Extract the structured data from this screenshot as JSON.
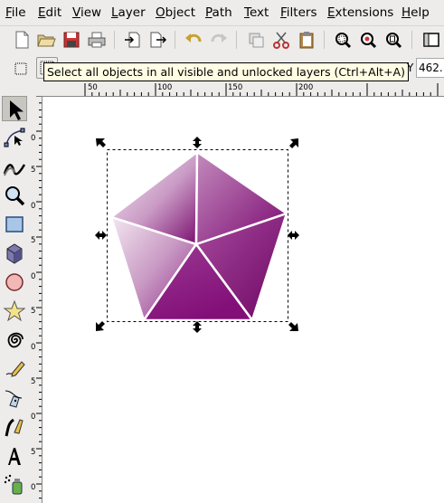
{
  "menu": [
    {
      "mnemonic": "F",
      "rest": "ile"
    },
    {
      "mnemonic": "E",
      "rest": "dit"
    },
    {
      "mnemonic": "V",
      "rest": "iew"
    },
    {
      "mnemonic": "L",
      "rest": "ayer"
    },
    {
      "mnemonic": "O",
      "rest": "bject"
    },
    {
      "mnemonic": "P",
      "rest": "ath"
    },
    {
      "mnemonic": "T",
      "rest": "ext"
    },
    {
      "mnemonic": "F",
      "rest": "ilters"
    },
    {
      "mnemonic": "E",
      "rest": "xtensions"
    },
    {
      "mnemonic": "H",
      "rest": "elp"
    }
  ],
  "tooltip": "Select all objects in all visible and unlocked layers (Ctrl+Alt+A)",
  "controls": {
    "y_label": "Y",
    "y_value": "462."
  },
  "hruler_labels": [
    "50",
    "100",
    "150",
    "200"
  ],
  "vruler_labels": [
    "0",
    "5",
    "0",
    "5",
    "0",
    "5",
    "0",
    "5",
    "0",
    "5",
    "0",
    "5",
    "0",
    "5"
  ],
  "tools": [
    "selector",
    "node",
    "tweak",
    "zoom",
    "rectangle",
    "3d-box",
    "ellipse",
    "star",
    "spiral",
    "pencil",
    "pen",
    "calligraphy",
    "text",
    "spray"
  ],
  "colors": {
    "accent_purple": "#8b1a7f",
    "light_purple": "#e6c8e3",
    "tooltip_bg": "#fffde3"
  }
}
